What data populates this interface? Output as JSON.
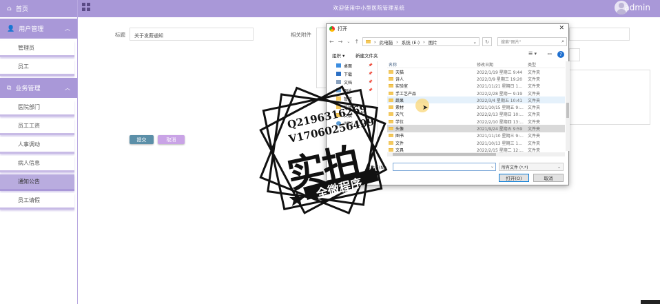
{
  "header": {
    "system_title": "欢迎使用中小型医院管理系统",
    "username": "admin"
  },
  "sidebar": {
    "home_label": "首页",
    "groups": [
      {
        "label": "用户管理",
        "items": [
          "管理员",
          "员工"
        ]
      },
      {
        "label": "业务管理",
        "items": [
          "医院部门",
          "员工工资",
          "人事调动",
          "病人信息",
          "通知公告",
          "员工请假"
        ]
      }
    ],
    "active_item": "通知公告"
  },
  "form": {
    "title_label": "标题",
    "title_value": "关于发薪通知",
    "attachment_label": "相关附件",
    "submit_label": "提交",
    "cancel_label": "取消"
  },
  "colors": {
    "brand": "#a998d8",
    "submit_button": "#5b8fa8",
    "cancel_button": "#c9a3e6"
  },
  "dialog": {
    "title": "打开",
    "path": [
      "此电脑",
      "系统 (E:)",
      "图片"
    ],
    "search_placeholder": "搜索\"图片\"",
    "organize_label": "组织 ▾",
    "new_folder_label": "新建文件夹",
    "nav_items": [
      {
        "label": "桌面",
        "icon": "desktop-icon"
      },
      {
        "label": "下载",
        "icon": "download-icon"
      },
      {
        "label": "文档",
        "icon": "document-icon"
      },
      {
        "label": "图片",
        "icon": "picture-icon"
      },
      {
        "label": "管道",
        "icon": "folder-icon"
      },
      {
        "label": "美妆",
        "icon": "folder-icon"
      },
      {
        "label": "女装",
        "icon": "folder-icon"
      },
      {
        "label": "WPS",
        "icon": "cloud-icon"
      }
    ],
    "columns": {
      "name": "名称",
      "date": "修改日期",
      "type": "类型"
    },
    "files": [
      {
        "name": "天猫",
        "date": "2022/1/19 星期三 9:44",
        "type": "文件夹"
      },
      {
        "name": "诗人",
        "date": "2022/3/9 星期三 19:20",
        "type": "文件夹"
      },
      {
        "name": "实验室",
        "date": "2021/11/21 星期日 1...",
        "type": "文件夹"
      },
      {
        "name": "手工艺产品",
        "date": "2022/2/28 星期一 9:19",
        "type": "文件夹"
      },
      {
        "name": "蔬果",
        "date": "2022/3/4 星期五 10:41",
        "type": "文件夹"
      },
      {
        "name": "素材",
        "date": "2021/10/15 星期五 9:...",
        "type": "文件夹"
      },
      {
        "name": "天气",
        "date": "2022/2/13 星期日 10:...",
        "type": "文件夹"
      },
      {
        "name": "学位",
        "date": "2022/2/10 星期四 13:...",
        "type": "文件夹"
      },
      {
        "name": "头像",
        "date": "2021/9/24 星期五 9:59",
        "type": "文件夹"
      },
      {
        "name": "图书",
        "date": "2021/11/10 星期三 9:...",
        "type": "文件夹"
      },
      {
        "name": "文件",
        "date": "2021/10/13 星期三 1...",
        "type": "文件夹"
      },
      {
        "name": "文具",
        "date": "2022/2/15 星期二 12:...",
        "type": "文件夹"
      }
    ],
    "filename_label": "文件名(N):",
    "filetype_value": "所有文件 (*.*)",
    "open_label": "打开(O)",
    "cancel_label": "取消"
  },
  "watermark": {
    "line1": "Q2196316269",
    "line2": "V17060256499",
    "main": "实拍",
    "banner": "全微程序"
  }
}
